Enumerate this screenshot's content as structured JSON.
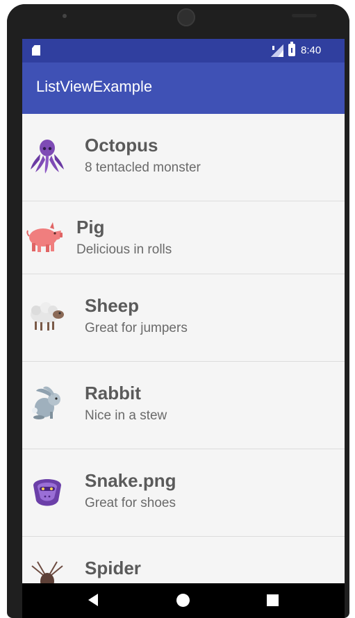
{
  "status_bar": {
    "time": "8:40",
    "icons": [
      "sd-card-icon",
      "signal-icon",
      "battery-icon"
    ]
  },
  "app_bar": {
    "title": "ListViewExample"
  },
  "colors": {
    "status_bar": "#303f9f",
    "app_bar": "#3f51b5",
    "list_bg": "#f5f5f5",
    "nav_bar": "#000000"
  },
  "items": [
    {
      "name": "Octopus",
      "description": "8 tentacled monster",
      "icon": "octopus-icon"
    },
    {
      "name": "Pig",
      "description": "Delicious in rolls",
      "icon": "pig-icon"
    },
    {
      "name": "Sheep",
      "description": "Great for jumpers",
      "icon": "sheep-icon"
    },
    {
      "name": "Rabbit",
      "description": "Nice in a stew",
      "icon": "rabbit-icon"
    },
    {
      "name": "Snake.png",
      "description": "Great for shoes",
      "icon": "snake-icon"
    },
    {
      "name": "Spider",
      "description": "",
      "icon": "spider-icon"
    }
  ],
  "nav_bar": {
    "buttons": [
      "back-icon",
      "home-icon",
      "recents-icon"
    ]
  }
}
